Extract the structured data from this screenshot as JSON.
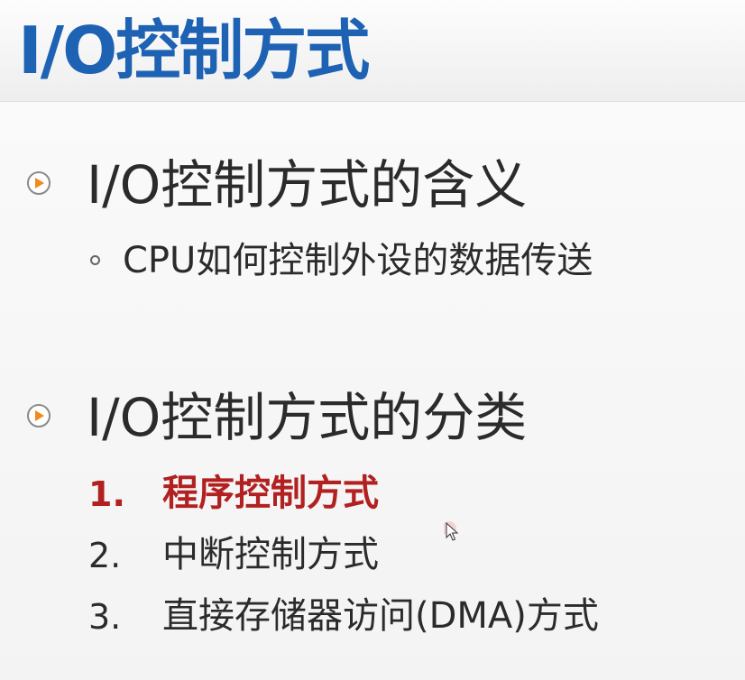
{
  "slide": {
    "title": "I/O控制方式",
    "sections": [
      {
        "icon": "play-circle-icon",
        "heading": "I/O控制方式的含义",
        "sub_items": [
          "CPU如何控制外设的数据传送"
        ]
      },
      {
        "icon": "play-circle-icon",
        "heading": "I/O控制方式的分类",
        "items": [
          {
            "number": "1.",
            "label": "程序控制方式",
            "highlighted": true
          },
          {
            "number": "2.",
            "label": "中断控制方式",
            "highlighted": false
          },
          {
            "number": "3.",
            "label": "直接存储器访问(DMA)方式",
            "highlighted": false
          }
        ]
      }
    ]
  },
  "colors": {
    "title": "#1e62b4",
    "text": "#2b2b2b",
    "highlight": "#b22020",
    "bullet_accent": "#f08a1a"
  },
  "cursor_icon": "mouse-pointer-icon"
}
